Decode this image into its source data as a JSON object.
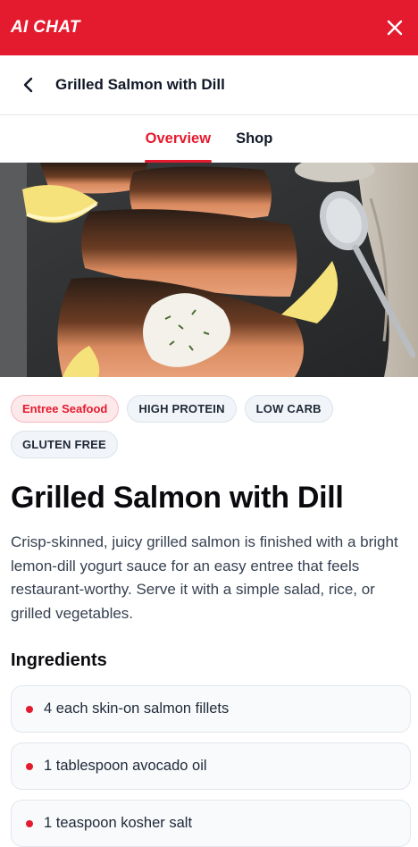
{
  "app_bar": {
    "title": "AI CHAT",
    "close_icon": "close-icon",
    "color": "#e41b2e"
  },
  "nav": {
    "back_icon": "chevron-left-icon",
    "title": "Grilled Salmon with Dill"
  },
  "tabs": [
    {
      "label": "Overview",
      "active": true
    },
    {
      "label": "Shop",
      "active": false
    }
  ],
  "hero_image": {
    "alt": "Grilled salmon fillets with dill yogurt sauce, lemon wedges and a spoon on slate"
  },
  "tags": [
    {
      "label": "Entree Seafood",
      "accent": true
    },
    {
      "label": "HIGH PROTEIN",
      "accent": false
    },
    {
      "label": "LOW CARB",
      "accent": false
    },
    {
      "label": "GLUTEN FREE",
      "accent": false
    }
  ],
  "recipe": {
    "title": "Grilled Salmon with Dill",
    "description": "Crisp-skinned, juicy grilled salmon is finished with a bright lemon-dill yogurt sauce for an easy entree that feels restaurant-worthy. Serve it with a simple salad, rice, or grilled vegetables."
  },
  "ingredients": {
    "heading": "Ingredients",
    "items": [
      "4 each skin-on salmon fillets",
      "1 tablespoon avocado oil",
      "1 teaspoon kosher salt"
    ]
  }
}
